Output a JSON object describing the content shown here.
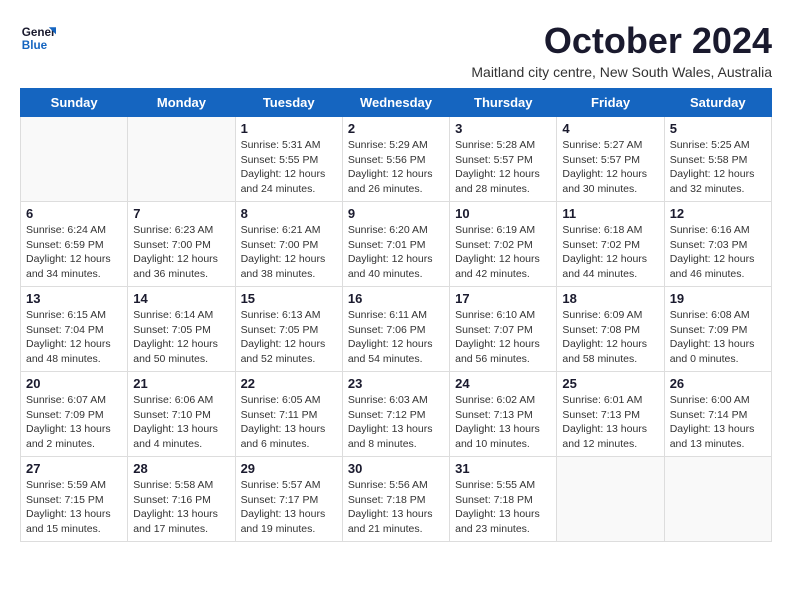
{
  "logo": {
    "line1": "General",
    "line2": "Blue"
  },
  "title": "October 2024",
  "subtitle": "Maitland city centre, New South Wales, Australia",
  "days_of_week": [
    "Sunday",
    "Monday",
    "Tuesday",
    "Wednesday",
    "Thursday",
    "Friday",
    "Saturday"
  ],
  "weeks": [
    [
      {
        "day": "",
        "info": ""
      },
      {
        "day": "",
        "info": ""
      },
      {
        "day": "1",
        "info": "Sunrise: 5:31 AM\nSunset: 5:55 PM\nDaylight: 12 hours\nand 24 minutes."
      },
      {
        "day": "2",
        "info": "Sunrise: 5:29 AM\nSunset: 5:56 PM\nDaylight: 12 hours\nand 26 minutes."
      },
      {
        "day": "3",
        "info": "Sunrise: 5:28 AM\nSunset: 5:57 PM\nDaylight: 12 hours\nand 28 minutes."
      },
      {
        "day": "4",
        "info": "Sunrise: 5:27 AM\nSunset: 5:57 PM\nDaylight: 12 hours\nand 30 minutes."
      },
      {
        "day": "5",
        "info": "Sunrise: 5:25 AM\nSunset: 5:58 PM\nDaylight: 12 hours\nand 32 minutes."
      }
    ],
    [
      {
        "day": "6",
        "info": "Sunrise: 6:24 AM\nSunset: 6:59 PM\nDaylight: 12 hours\nand 34 minutes."
      },
      {
        "day": "7",
        "info": "Sunrise: 6:23 AM\nSunset: 7:00 PM\nDaylight: 12 hours\nand 36 minutes."
      },
      {
        "day": "8",
        "info": "Sunrise: 6:21 AM\nSunset: 7:00 PM\nDaylight: 12 hours\nand 38 minutes."
      },
      {
        "day": "9",
        "info": "Sunrise: 6:20 AM\nSunset: 7:01 PM\nDaylight: 12 hours\nand 40 minutes."
      },
      {
        "day": "10",
        "info": "Sunrise: 6:19 AM\nSunset: 7:02 PM\nDaylight: 12 hours\nand 42 minutes."
      },
      {
        "day": "11",
        "info": "Sunrise: 6:18 AM\nSunset: 7:02 PM\nDaylight: 12 hours\nand 44 minutes."
      },
      {
        "day": "12",
        "info": "Sunrise: 6:16 AM\nSunset: 7:03 PM\nDaylight: 12 hours\nand 46 minutes."
      }
    ],
    [
      {
        "day": "13",
        "info": "Sunrise: 6:15 AM\nSunset: 7:04 PM\nDaylight: 12 hours\nand 48 minutes."
      },
      {
        "day": "14",
        "info": "Sunrise: 6:14 AM\nSunset: 7:05 PM\nDaylight: 12 hours\nand 50 minutes."
      },
      {
        "day": "15",
        "info": "Sunrise: 6:13 AM\nSunset: 7:05 PM\nDaylight: 12 hours\nand 52 minutes."
      },
      {
        "day": "16",
        "info": "Sunrise: 6:11 AM\nSunset: 7:06 PM\nDaylight: 12 hours\nand 54 minutes."
      },
      {
        "day": "17",
        "info": "Sunrise: 6:10 AM\nSunset: 7:07 PM\nDaylight: 12 hours\nand 56 minutes."
      },
      {
        "day": "18",
        "info": "Sunrise: 6:09 AM\nSunset: 7:08 PM\nDaylight: 12 hours\nand 58 minutes."
      },
      {
        "day": "19",
        "info": "Sunrise: 6:08 AM\nSunset: 7:09 PM\nDaylight: 13 hours\nand 0 minutes."
      }
    ],
    [
      {
        "day": "20",
        "info": "Sunrise: 6:07 AM\nSunset: 7:09 PM\nDaylight: 13 hours\nand 2 minutes."
      },
      {
        "day": "21",
        "info": "Sunrise: 6:06 AM\nSunset: 7:10 PM\nDaylight: 13 hours\nand 4 minutes."
      },
      {
        "day": "22",
        "info": "Sunrise: 6:05 AM\nSunset: 7:11 PM\nDaylight: 13 hours\nand 6 minutes."
      },
      {
        "day": "23",
        "info": "Sunrise: 6:03 AM\nSunset: 7:12 PM\nDaylight: 13 hours\nand 8 minutes."
      },
      {
        "day": "24",
        "info": "Sunrise: 6:02 AM\nSunset: 7:13 PM\nDaylight: 13 hours\nand 10 minutes."
      },
      {
        "day": "25",
        "info": "Sunrise: 6:01 AM\nSunset: 7:13 PM\nDaylight: 13 hours\nand 12 minutes."
      },
      {
        "day": "26",
        "info": "Sunrise: 6:00 AM\nSunset: 7:14 PM\nDaylight: 13 hours\nand 13 minutes."
      }
    ],
    [
      {
        "day": "27",
        "info": "Sunrise: 5:59 AM\nSunset: 7:15 PM\nDaylight: 13 hours\nand 15 minutes."
      },
      {
        "day": "28",
        "info": "Sunrise: 5:58 AM\nSunset: 7:16 PM\nDaylight: 13 hours\nand 17 minutes."
      },
      {
        "day": "29",
        "info": "Sunrise: 5:57 AM\nSunset: 7:17 PM\nDaylight: 13 hours\nand 19 minutes."
      },
      {
        "day": "30",
        "info": "Sunrise: 5:56 AM\nSunset: 7:18 PM\nDaylight: 13 hours\nand 21 minutes."
      },
      {
        "day": "31",
        "info": "Sunrise: 5:55 AM\nSunset: 7:18 PM\nDaylight: 13 hours\nand 23 minutes."
      },
      {
        "day": "",
        "info": ""
      },
      {
        "day": "",
        "info": ""
      }
    ]
  ]
}
